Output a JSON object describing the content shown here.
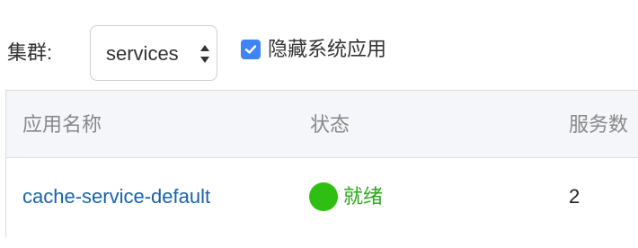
{
  "toolbar": {
    "cluster_label": "集群:",
    "cluster_select": {
      "selected": "services"
    },
    "hide_system_apps": {
      "checked": true,
      "label": "隐藏系统应用"
    }
  },
  "table": {
    "columns": [
      "应用名称",
      "状态",
      "服务数"
    ],
    "rows": [
      {
        "app_name": "cache-service-default",
        "status": "就绪",
        "service_count": "2"
      }
    ]
  },
  "colors": {
    "checkbox": "#3f84f5",
    "link": "#1a63aa",
    "status_ready_dot": "#2fbf13",
    "status_ready_text": "#2aa818",
    "header_bg": "#f5f6fa"
  },
  "icons": {
    "select_arrows": "chevron-up-down-icon",
    "checkbox": "checkmark-icon",
    "status": "status-dot-icon"
  }
}
